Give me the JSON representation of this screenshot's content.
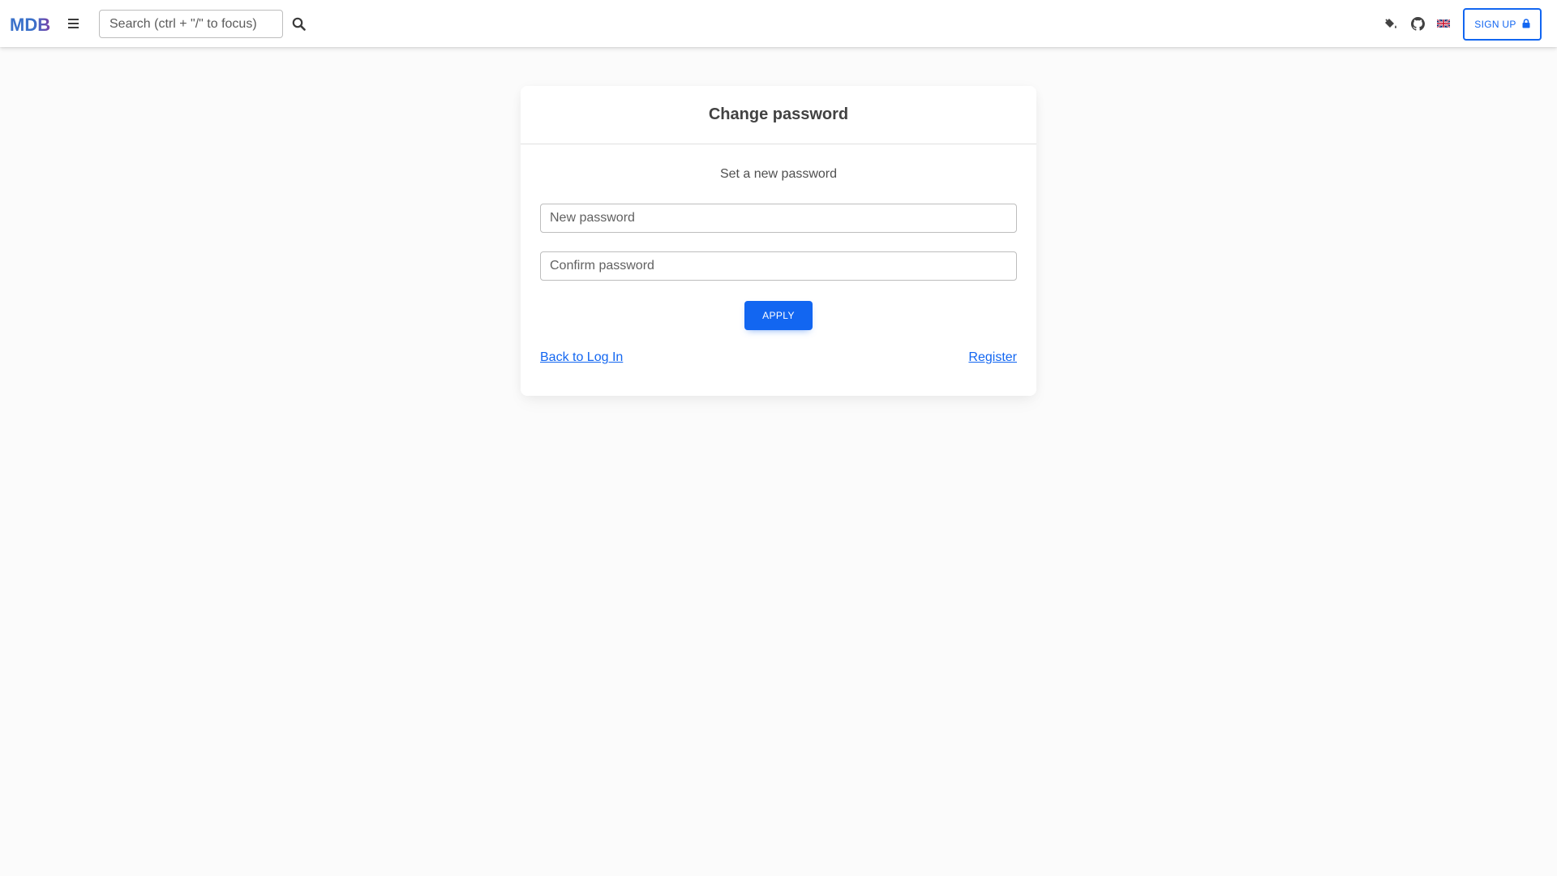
{
  "navbar": {
    "logo_text": "MDB",
    "menu_icon": "hamburger-menu-icon",
    "search": {
      "placeholder": "Search (ctrl + \"/\" to focus)",
      "value": "",
      "icon": "search-icon"
    },
    "icons": [
      "paint-bucket-icon",
      "github-icon",
      "uk-flag-icon"
    ],
    "signup_label": "SIGN UP",
    "signup_icon": "lock-icon"
  },
  "card": {
    "title": "Change password",
    "subtitle": "Set a new password",
    "new_password": {
      "placeholder": "New password",
      "value": ""
    },
    "confirm_password": {
      "placeholder": "Confirm password",
      "value": ""
    },
    "apply_label": "APPLY",
    "back_link": "Back to Log In",
    "register_link": "Register"
  },
  "colors": {
    "primary": "#1266f1",
    "background": "#fbfbfb",
    "logo_blue": "#3b71ca",
    "logo_purple": "#7b3fa6"
  }
}
